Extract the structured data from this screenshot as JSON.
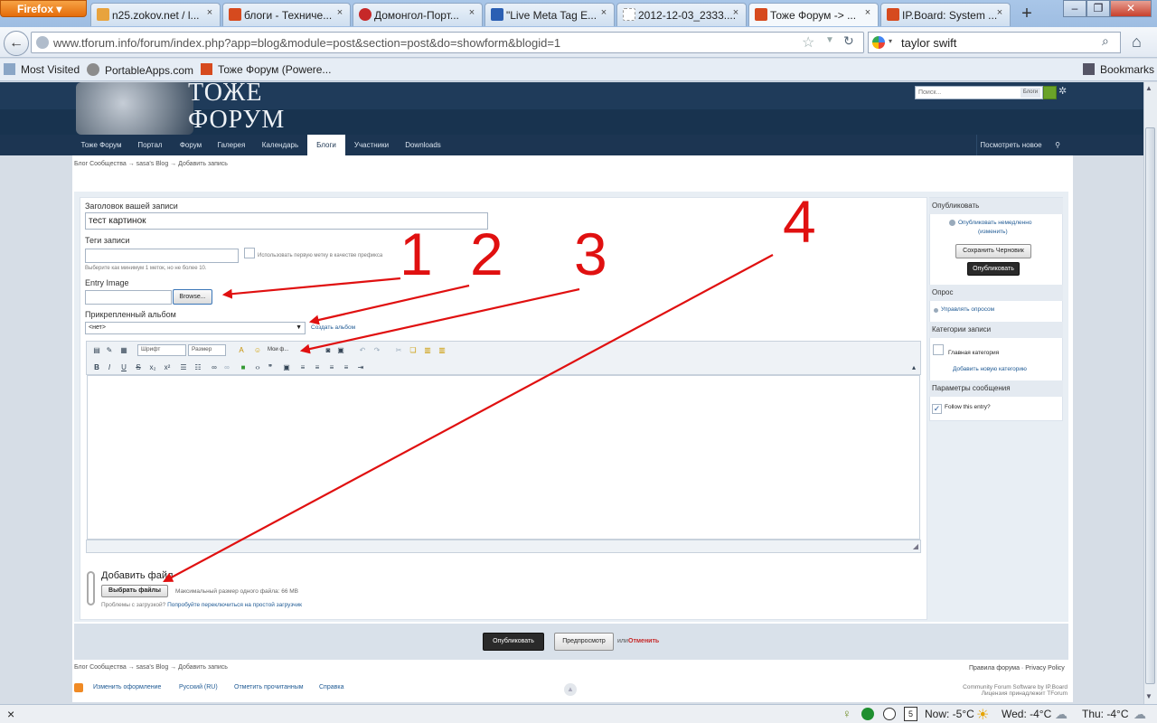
{
  "browser": {
    "app_button": "Firefox",
    "tabs": [
      {
        "title": "n25.zokov.net / l...",
        "favicon": "PMA",
        "color": "#e8a33d"
      },
      {
        "title": "блоги - Техниче...",
        "favicon": "T",
        "color": "#d64a1e"
      },
      {
        "title": "Домонгол-Порт...",
        "favicon": "lifebuoy",
        "color": "#c62828"
      },
      {
        "title": "\"Live Meta Tag E...",
        "favicon": "V",
        "color": "#2b5fb3"
      },
      {
        "title": "2012-12-03_2333....",
        "favicon": "blank",
        "color": "#cccccc"
      },
      {
        "title": "Тоже Форум -> ...",
        "favicon": "T",
        "color": "#d64a1e"
      },
      {
        "title": "IP.Board: System ...",
        "favicon": "T",
        "color": "#d64a1e"
      }
    ],
    "new_tab": "+",
    "url": "www.tforum.info/forum/index.php?app=blog&module=post&section=post&do=showform&blogid=1",
    "search_value": "taylor swift",
    "bookmarks": [
      "Most Visited",
      "PortableApps.com",
      "Тоже Форум (Powere..."
    ],
    "bookmarks_menu": "Bookmarks"
  },
  "site": {
    "logo_line1": "ТОЖЕ",
    "logo_line2": "ФОРУМ",
    "search_placeholder": "Поиск...",
    "search_scope": "Блоги",
    "menu": [
      "Тоже Форум",
      "Портал",
      "Форум",
      "Галерея",
      "Календарь",
      "Блоги",
      "Участники",
      "Downloads"
    ],
    "active_menu": "Блоги",
    "view_new": "Посмотреть новое",
    "breadcrumb": [
      "Блог Сообщества",
      "sasa's Blog",
      "Добавить запись"
    ],
    "breadcrumb_sep": "→"
  },
  "form": {
    "title_label": "Заголовок вашей записи",
    "title_value": "тест картинок",
    "tags_label": "Теги записи",
    "tags_checkbox_label": "Использовать первую метку в качестве префикса",
    "tags_hint": "Выберите как минимум 1 меток, но не более 10.",
    "entry_image_label": "Entry Image",
    "browse_button": "Browse...",
    "album_label": "Прикрепленный альбом",
    "album_value": "<нет>",
    "create_album": "Создать альбом",
    "font_select": "Шрифт",
    "size_select": "Размер",
    "my_media": "Мои ф...",
    "attach_label": "Добавить файл",
    "choose_files_button": "Выбрать файлы",
    "max_size": "Максимальный размер одного файла: 66 MB",
    "upload_problems": "Проблемы с загрузкой?",
    "simple_uploader": "Попробуйте переключиться на простой загрузчик"
  },
  "sidebar": {
    "publish_heading": "Опубликовать",
    "publish_now": "Опубликовать немедленно",
    "change": "(изменить)",
    "save_draft": "Сохранить Черновик",
    "publish_button": "Опубликовать",
    "poll_heading": "Опрос",
    "manage_poll": "Управлять опросом",
    "categories_heading": "Категории записи",
    "main_category": "Главная категория",
    "add_category": "Добавить новую категорию",
    "message_params_heading": "Параметры сообщения",
    "follow_entry": "Follow this entry?"
  },
  "actions": {
    "publish": "Опубликовать",
    "preview": "Предпросмотр",
    "or": "или",
    "cancel": "Отменить"
  },
  "footer": {
    "breadcrumb": [
      "Блог Сообщества",
      "sasa's Blog",
      "Добавить запись"
    ],
    "links_right": [
      "Правила форума",
      "Privacy Policy"
    ],
    "bottom_links": [
      "Изменить оформление",
      "Русский (RU)",
      "Отметить прочитанным",
      "Справка"
    ],
    "credit_line1": "Community Forum Software by IP.Board",
    "credit_line2": "Лицензия принадлежит TForum"
  },
  "status_bar": {
    "close": "×",
    "calendar_day": "5",
    "weather_now": "Now: -5°C",
    "weather_wed": "Wed: -4°C",
    "weather_thu": "Thu: -4°C"
  },
  "annotations": [
    "1",
    "2",
    "3",
    "4"
  ],
  "colors": {
    "header": "#1f3b5a",
    "menu": "#1c3552",
    "annotation": "#e01010",
    "cancel": "#c62828",
    "link": "#1f5a94"
  }
}
